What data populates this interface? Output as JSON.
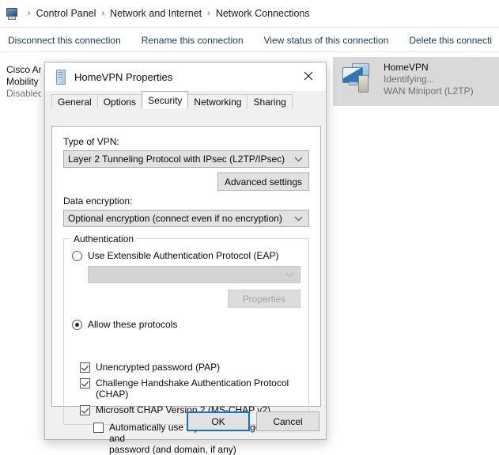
{
  "explorer": {
    "breadcrumb": {
      "icon": "network-computer-icon",
      "separator": "›",
      "items": [
        "Control Panel",
        "Network and Internet",
        "Network Connections"
      ]
    },
    "toolbar": {
      "links": [
        "Disconnect this connection",
        "Rename this connection",
        "View status of this connection",
        "Delete this connecti"
      ]
    },
    "connections": [
      {
        "name": "Cisco An",
        "name2": "Mobility",
        "status": "Disabled",
        "device": ""
      },
      {
        "name": "HomeVPN",
        "status": "Identifying...",
        "device": "WAN Miniport (L2TP)"
      }
    ]
  },
  "dialog": {
    "title": "HomeVPN Properties",
    "title_icon": "vpn-properties-icon",
    "close_label": "✕",
    "tabs": [
      {
        "label": "General",
        "active": false
      },
      {
        "label": "Options",
        "active": false
      },
      {
        "label": "Security",
        "active": true
      },
      {
        "label": "Networking",
        "active": false
      },
      {
        "label": "Sharing",
        "active": false
      }
    ],
    "security": {
      "vpn_type_label": "Type of VPN:",
      "vpn_type_value": "Layer 2 Tunneling Protocol with IPsec (L2TP/IPsec)",
      "advanced_settings_label": "Advanced settings",
      "data_encryption_label": "Data encryption:",
      "data_encryption_value": "Optional encryption (connect even if no encryption)",
      "authentication": {
        "group_title": "Authentication",
        "eap_radio_label": "Use Extensible Authentication Protocol (EAP)",
        "eap_radio_checked": false,
        "eap_combo_value": "",
        "eap_properties_label": "Properties",
        "allow_protocols_label": "Allow these protocols",
        "allow_protocols_checked": true,
        "protocols": [
          {
            "label": "Unencrypted password (PAP)",
            "checked": true
          },
          {
            "label": "Challenge Handshake Authentication Protocol (CHAP)",
            "checked": true
          },
          {
            "label": "Microsoft CHAP Version 2 (MS-CHAP v2)",
            "checked": true
          }
        ],
        "auto_logon_line1": "Automatically use my Windows logon name and",
        "auto_logon_line2": "password (and domain, if any)",
        "auto_logon_checked": false
      }
    },
    "buttons": {
      "ok_label": "OK",
      "cancel_label": "Cancel"
    }
  },
  "colors": {
    "accent": "#1771bc",
    "link": "#1a3a5c",
    "selection": "#d9d9d9"
  }
}
